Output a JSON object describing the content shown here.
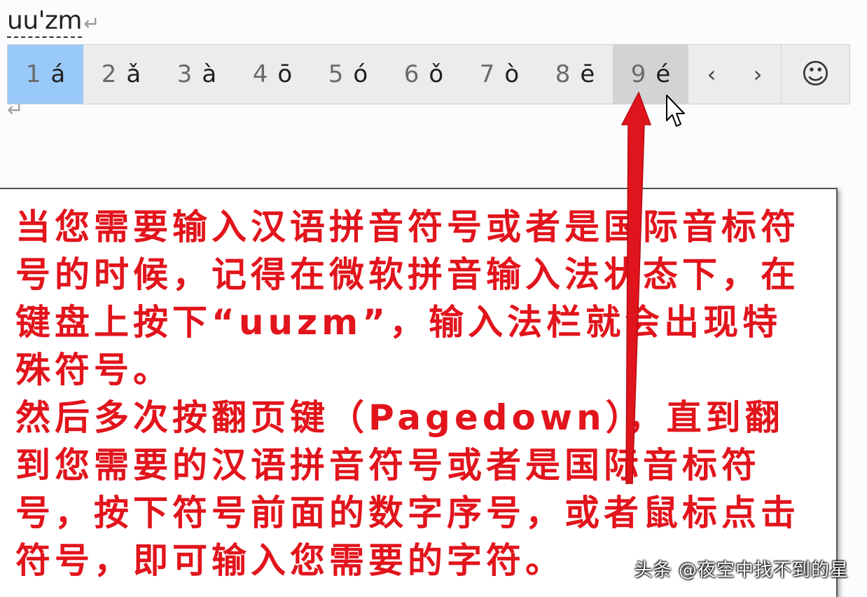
{
  "composition": {
    "text": "uu'zm",
    "return_symbol": "↵"
  },
  "candidates": [
    {
      "num": "1",
      "char": "á",
      "state": "selected"
    },
    {
      "num": "2",
      "char": "ǎ",
      "state": "normal"
    },
    {
      "num": "3",
      "char": "à",
      "state": "normal"
    },
    {
      "num": "4",
      "char": "ō",
      "state": "normal"
    },
    {
      "num": "5",
      "char": "ó",
      "state": "normal"
    },
    {
      "num": "6",
      "char": "ǒ",
      "state": "normal"
    },
    {
      "num": "7",
      "char": "ò",
      "state": "normal"
    },
    {
      "num": "8",
      "char": "ē",
      "state": "normal"
    },
    {
      "num": "9",
      "char": "é",
      "state": "hover"
    }
  ],
  "nav": {
    "prev": "‹",
    "next": "›",
    "emoji": "☺"
  },
  "icons": {
    "prev": "chevron-left-icon",
    "next": "chevron-right-icon",
    "emoji": "smiley-icon",
    "cursor": "mouse-pointer-icon",
    "arrow": "red-arrow-icon"
  },
  "colors": {
    "instruction_text": "#e2141c",
    "selected_candidate": "#99c9f8",
    "hover_candidate": "#d3d3d6",
    "candidate_bar": "#ececee",
    "arrow": "#e0141c"
  },
  "instructions": {
    "paragraph1": "当您需要输入汉语拼音符号或者是国际音标符号的时候，记得在微软拼音输入法状态下，在键盘上按下“uuzm”，输入法栏就会出现特殊符号。",
    "paragraph2": "然后多次按翻页键（Pagedown），直到翻到您需要的汉语拼音符号或者是国际音标符号，按下符号前面的数字序号，或者鼠标点击符号，即可输入您需要的字符。"
  },
  "watermark": "头条 @夜空中找不到的星"
}
